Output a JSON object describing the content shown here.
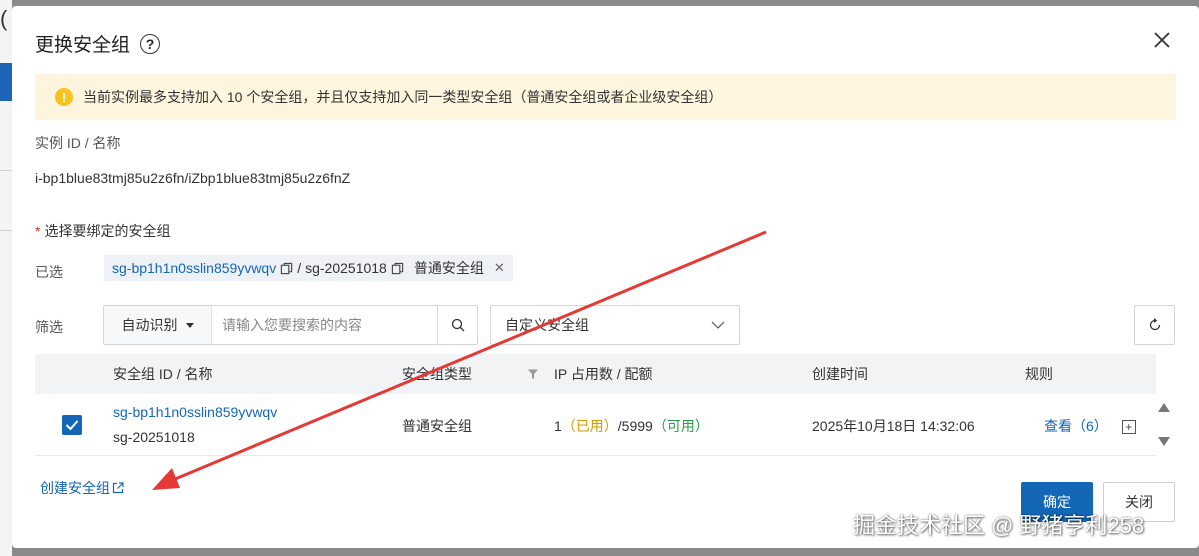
{
  "dialog": {
    "title": "更换安全组",
    "alert_text": "当前实例最多支持加入 10 个安全组，并且仅支持加入同一类型安全组（普通安全组或者企业级安全组）",
    "instance_label": "实例 ID / 名称",
    "instance_value": "i-bp1blue83tmj85u2z6fn/iZbp1blue83tmj85u2z6fnZ",
    "required_star": "*",
    "select_label": "选择要绑定的安全组",
    "selected_label": "已选",
    "selected_tag": {
      "id": "sg-bp1h1n0sslin859yvwqv",
      "separator": "/",
      "name": "sg-20251018",
      "type": "普通安全组"
    },
    "filter_label": "筛选",
    "filter_mode": "自动识别",
    "search_placeholder": "请输入您要搜索的内容",
    "sg_type_select": "自定义安全组",
    "table": {
      "headers": {
        "id_name": "安全组 ID / 名称",
        "type": "安全组类型",
        "ip": "IP 占用数 / 配额",
        "created": "创建时间",
        "rules": "规则"
      },
      "rows": [
        {
          "id": "sg-bp1h1n0sslin859yvwqv",
          "name": "sg-20251018",
          "type": "普通安全组",
          "ip_used_count": "1",
          "ip_used_label": "（已用）",
          "ip_quota": "/5999",
          "ip_avail_label": "（可用）",
          "created": "2025年10月18日 14:32:06",
          "rules_link": "查看",
          "rules_count": "（6）"
        }
      ]
    },
    "create_link": "创建安全组",
    "ok_button": "确定",
    "cancel_button": "关闭"
  },
  "watermark": "掘金技术社区 @ 野猪亨利258",
  "colors": {
    "primary": "#1466b6",
    "alert_bg": "#fdf5dd",
    "warning": "#f7c322",
    "used": "#d69a00",
    "available": "#24a148",
    "annotation_arrow": "#e53935"
  }
}
